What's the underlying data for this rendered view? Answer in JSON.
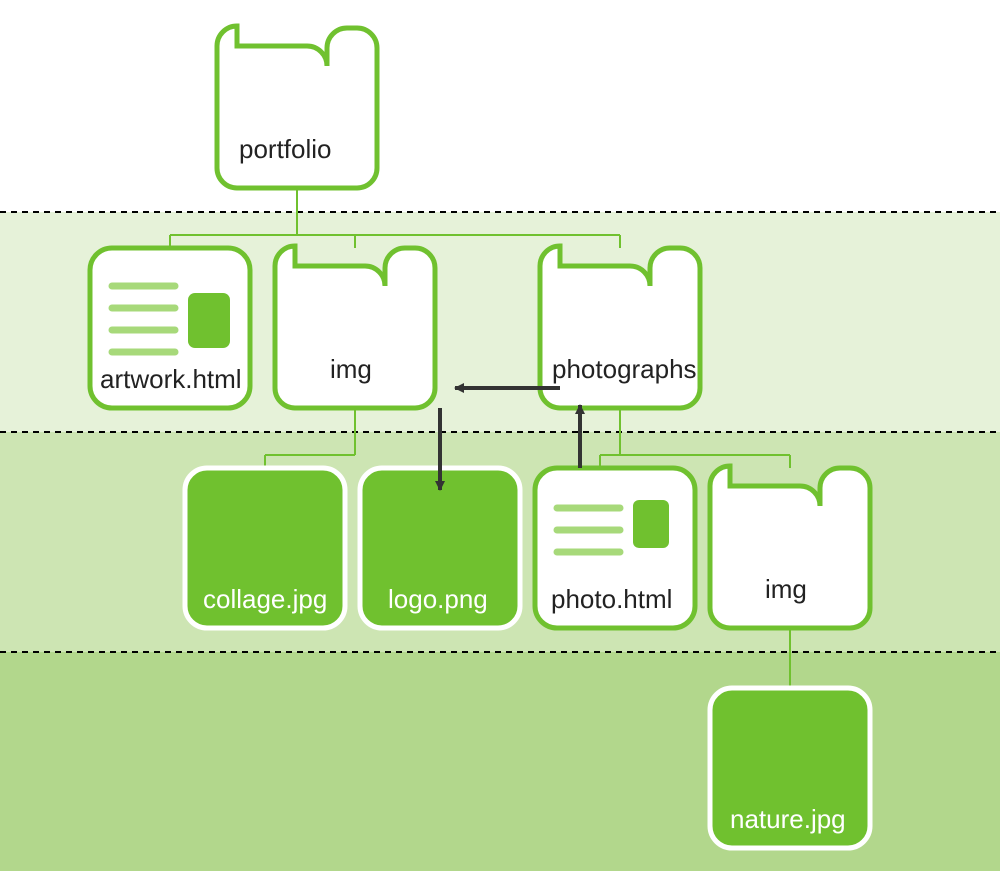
{
  "colors": {
    "green": "#70c12f",
    "green_light": "#a7d97a",
    "band1": "#e6f2d9",
    "band2": "#cde5b3",
    "band3": "#b2d78c",
    "arrow": "#333333"
  },
  "nodes": {
    "portfolio": {
      "label": "portfolio",
      "type": "folder",
      "fill": "white"
    },
    "artwork": {
      "label": "artwork.html",
      "type": "html",
      "fill": "white"
    },
    "img1": {
      "label": "img",
      "type": "folder",
      "fill": "white"
    },
    "photographs": {
      "label": "photographs",
      "type": "folder",
      "fill": "white"
    },
    "collage": {
      "label": "collage.jpg",
      "type": "image",
      "fill": "green"
    },
    "logo": {
      "label": "logo.png",
      "type": "image",
      "fill": "green"
    },
    "photo": {
      "label": "photo.html",
      "type": "html",
      "fill": "white"
    },
    "img2": {
      "label": "img",
      "type": "folder",
      "fill": "white"
    },
    "nature": {
      "label": "nature.jpg",
      "type": "image",
      "fill": "green"
    }
  }
}
